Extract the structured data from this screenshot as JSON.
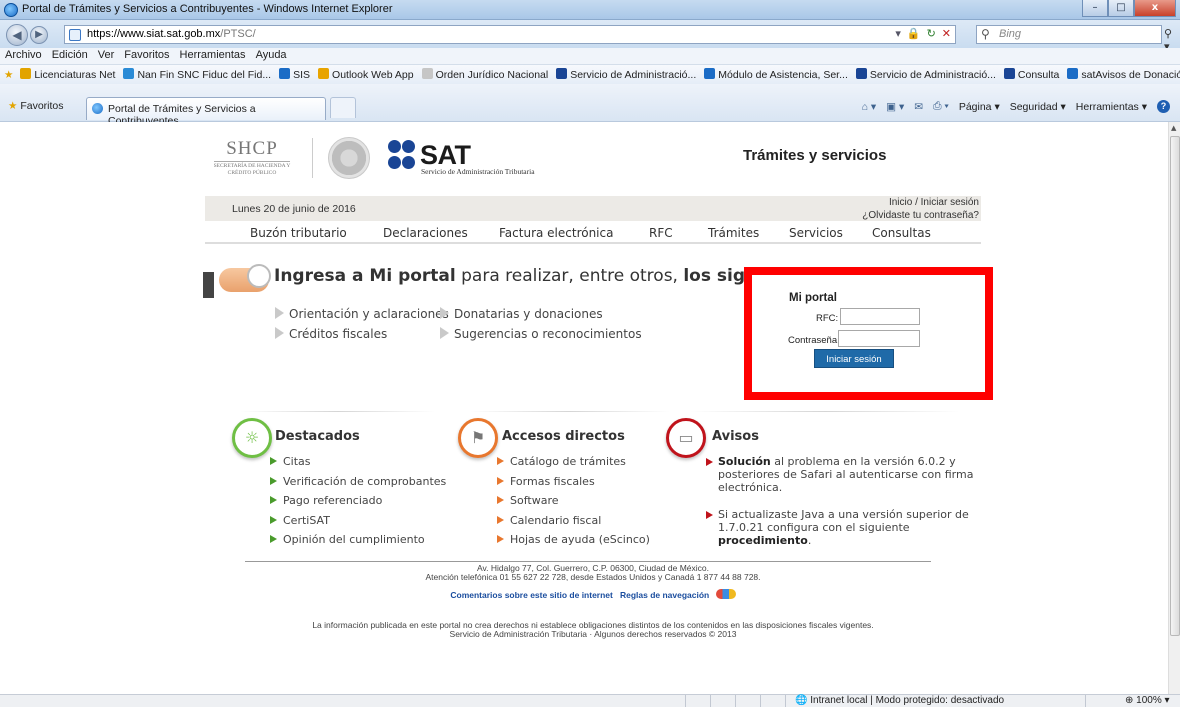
{
  "window": {
    "title": "Portal de Trámites y Servicios a Contribuyentes - Windows Internet Explorer",
    "minimize": "–",
    "maximize": "□",
    "close": "x"
  },
  "address": {
    "url_host": "https://www.siat.sat.gob.mx",
    "url_path": "/PTSC/",
    "search_placeholder": "Bing"
  },
  "menu": [
    "Archivo",
    "Edición",
    "Ver",
    "Favoritos",
    "Herramientas",
    "Ayuda"
  ],
  "favorites_bar": [
    {
      "label": "Licenciaturas Net",
      "color": "#e2a400"
    },
    {
      "label": "Nan Fin SNC Fiduc del Fid...",
      "color": "#2a8bd6"
    },
    {
      "label": "SIS",
      "color": "#1b6cc6"
    },
    {
      "label": "Outlook Web App",
      "color": "#e8a400"
    },
    {
      "label": "Orden Jurídico Nacional",
      "color": "#c6c6c6"
    },
    {
      "label": "Servicio de Administració...",
      "color": "#1a4595"
    },
    {
      "label": "Módulo de Asistencia, Ser...",
      "color": "#1b6cc6"
    },
    {
      "label": "Servicio de Administració...",
      "color": "#1a4595"
    },
    {
      "label": "Consulta",
      "color": "#1a4595"
    },
    {
      "label": "satAvisos de Donación y ...",
      "color": "#1b6cc6"
    }
  ],
  "command_bar": {
    "favorites": "Favoritos",
    "tab_title": "Portal de Trámites y Servicios a Contribuyentes",
    "tools": [
      "Página ▾",
      "Seguridad ▾",
      "Herramientas ▾"
    ]
  },
  "page": {
    "shcp": "SHCP",
    "shcp_sub": "SECRETARÍA DE HACIENDA Y CRÉDITO PÚBLICO",
    "sat": "SAT",
    "sat_sub": "Servicio de Administración Tributaria",
    "section_title": "Trámites y servicios",
    "date": "Lunes 20 de junio de 2016",
    "inicio": "Inicio / Iniciar sesión",
    "olvidaste": "¿Olvidaste tu contraseña?",
    "nav": [
      "Buzón tributario",
      "Declaraciones",
      "Factura electrónica",
      "RFC",
      "Trámites",
      "Servicios",
      "Consultas"
    ],
    "headline": {
      "bold1": "Ingresa a Mi portal",
      "mid": " para realizar, entre otros, ",
      "bold2": "los siguientes trámites:"
    },
    "tramites_col1": [
      "Orientación y aclaraciones",
      "Créditos fiscales"
    ],
    "tramites_col2": [
      "Donatarias y donaciones",
      "Sugerencias o reconocimientos"
    ],
    "login": {
      "title": "Mi portal",
      "rfc_label": "RFC:",
      "password_label": "Contraseña:",
      "button": "Iniciar sesión",
      "highlight_color": "#ff0000"
    },
    "destacados": {
      "title": "Destacados",
      "color": "#6fbf44",
      "items": [
        "Citas",
        "Verificación de comprobantes",
        "Pago referenciado",
        "CertiSAT",
        "Opinión del cumplimiento"
      ]
    },
    "accesos": {
      "title": "Accesos directos",
      "color": "#e8772e",
      "items": [
        "Catálogo de trámites",
        "Formas fiscales",
        "Software",
        "Calendario fiscal",
        "Hojas de ayuda (eScinco)"
      ]
    },
    "avisos": {
      "title": "Avisos",
      "color": "#c0131b",
      "p1_bold": "Solución",
      "p1_rest": " al problema en la versión 6.0.2 y posteriores de Safari al autenticarse con firma electrónica.",
      "p2_text": "Si actualizaste Java a una versión superior de 1.7.0.21 configura con el siguiente ",
      "p2_bold": "procedimiento",
      "p2_end": "."
    },
    "footer": {
      "address": "Av. Hidalgo 77, Col. Guerrero, C.P. 06300, Ciudad de México.",
      "phone": "Atención telefónica 01 55 627 22 728, desde Estados Unidos y Canadá 1 877 44 88 728.",
      "link1": "Comentarios sobre este sitio de internet",
      "link2": "Reglas de navegación",
      "legal1": "La información publicada en este portal no crea derechos ni establece obligaciones distintos de los contenidos en las disposiciones fiscales vigentes.",
      "legal2": "Servicio de Administración Tributaria · Algunos derechos reservados © 2013"
    }
  },
  "status": {
    "zone": "Intranet local | Modo protegido: desactivado",
    "zoom": "100%"
  }
}
